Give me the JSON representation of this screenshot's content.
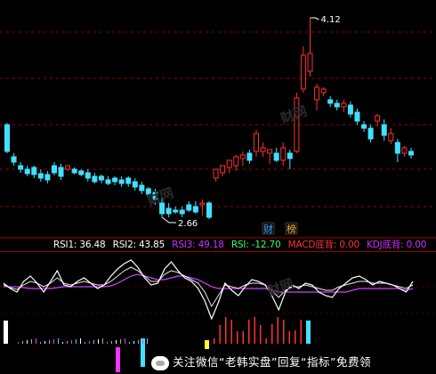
{
  "main_chart": {
    "high_label": "4.12",
    "low_label": "2.66",
    "tags": [
      {
        "text": "财",
        "color": "#3aa0ff"
      },
      {
        "text": "榜",
        "color": "#f0b030"
      }
    ],
    "colors": {
      "up": "#ff3030",
      "down": "#40e0ff",
      "grid": "#a00000",
      "label": "#ffffff"
    }
  },
  "indicator_legend": [
    {
      "text": "RSI1: 36.48",
      "color": "#ffffff"
    },
    {
      "text": "RSI2: 43.85",
      "color": "#ffffff"
    },
    {
      "text": "RSI3: 49.18",
      "color": "#cc33ff"
    },
    {
      "text": "RSI: -12.70",
      "color": "#33ff66"
    },
    {
      "text": "MACD底背: 0.00",
      "color": "#ff3333"
    },
    {
      "text": "KDJ底背: 0.00",
      "color": "#cc33ff"
    }
  ],
  "sub_chart": {
    "colors": {
      "rsi1": "#ffffff",
      "rsi2": "#e8e8e8",
      "rsi3": "#cc44ff",
      "bar_up": "#ff3333",
      "bar_down": "#40e0ff"
    }
  },
  "watermark": {
    "prefix": "关注微信",
    "name": "“老韩实盘”",
    "middle": "回复",
    "keyword": "“指标”",
    "suffix": "免费领"
  },
  "decorative_watermark": "财网"
}
